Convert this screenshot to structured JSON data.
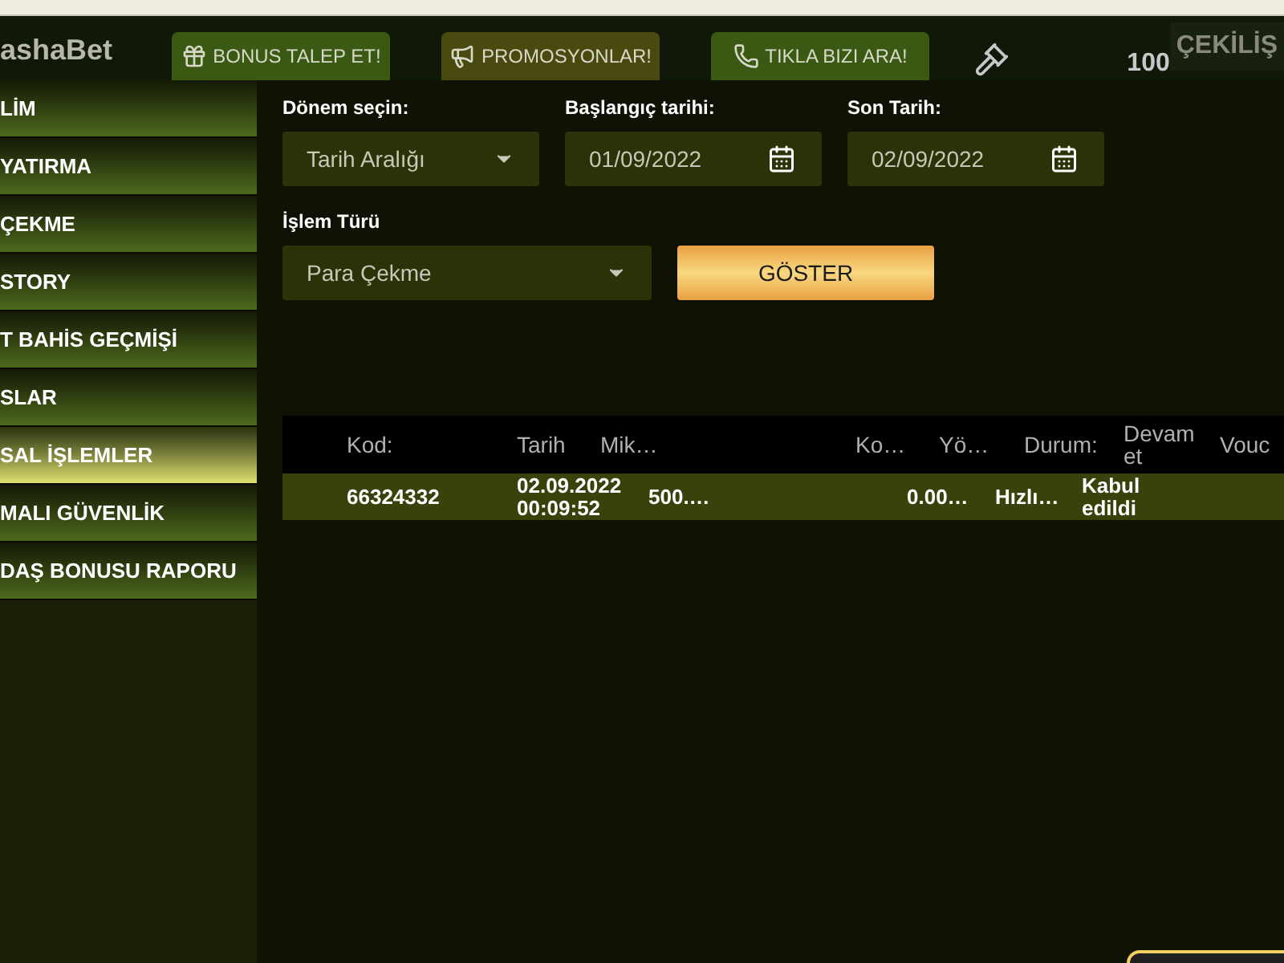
{
  "header": {
    "logo": "ashaBet",
    "buttons": [
      {
        "label": "BONUS TALEP ET!",
        "kind": "gift",
        "color": "#3a5a14"
      },
      {
        "label": "PROMOSYONLAR!",
        "kind": "megaphone",
        "color": "#4a4a10"
      },
      {
        "label": "TIKLA BIZI ARA!",
        "kind": "phone",
        "color": "#3a5a14"
      }
    ],
    "counter": "100",
    "raffle": "ÇEKİLİŞ"
  },
  "sidebar": {
    "items": [
      {
        "label": "LİM",
        "selected": false
      },
      {
        "label": "YATIRMA",
        "selected": false
      },
      {
        "label": "ÇEKME",
        "selected": false
      },
      {
        "label": "STORY",
        "selected": false
      },
      {
        "label": "T BAHİS GEÇMİŞİ",
        "selected": false
      },
      {
        "label": "SLAR",
        "selected": false
      },
      {
        "label": "SAL İŞLEMLER",
        "selected": true
      },
      {
        "label": "MALI GÜVENLİK",
        "selected": false
      },
      {
        "label": "DAŞ BONUSU RAPORU",
        "selected": false
      }
    ]
  },
  "filters": {
    "period": {
      "label": "Dönem seçin:",
      "value": "Tarih Aralığı"
    },
    "start": {
      "label": "Başlangıç tarihi:",
      "value": "01/09/2022"
    },
    "end": {
      "label": "Son Tarih:",
      "value": "02/09/2022"
    },
    "type": {
      "label": "İşlem Türü",
      "value": "Para Çekme"
    },
    "submit": "GÖSTER"
  },
  "table": {
    "columns": [
      "Kod:",
      "Tarih",
      "Mik…",
      "Ko…",
      "Yö…",
      "Durum:",
      "Devam et",
      "Vouc"
    ],
    "rows": [
      {
        "cells": [
          "66324332",
          "02.09.2022 00:09:52",
          "500.…",
          "0.00…",
          "Hızlı…",
          "Kabul edildi"
        ]
      }
    ]
  }
}
